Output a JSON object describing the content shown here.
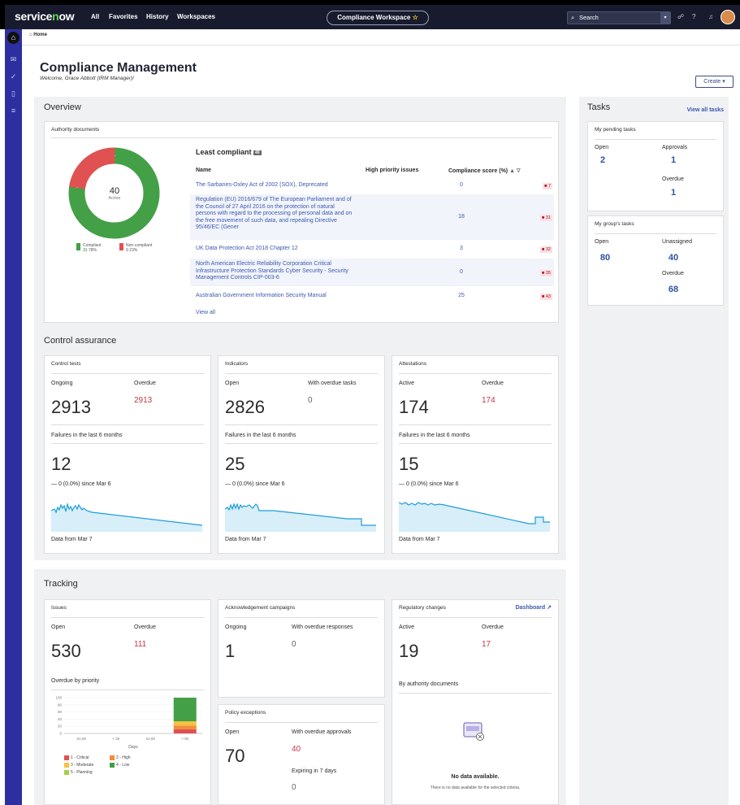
{
  "topbar": {
    "brand": "servicenow",
    "nav": [
      "All",
      "Favorites",
      "History",
      "Workspaces"
    ],
    "workspace": "Compliance Workspace",
    "search_placeholder": "Search"
  },
  "breadcrumb": "Home",
  "page": {
    "title": "Compliance Management",
    "welcome": "Welcome, Grace Abbott (IRM Manager)!",
    "create_label": "Create ▾"
  },
  "overview": {
    "heading": "Overview",
    "authority": {
      "title": "Authority documents",
      "center_value": "40",
      "center_label": "Active",
      "legend": [
        {
          "label": "Compliant",
          "count": "31",
          "pct": "78%",
          "color": "#43a047"
        },
        {
          "label": "Non-compliant",
          "count": "9",
          "pct": "23%",
          "color": "#e05252"
        }
      ],
      "least_title": "Least compliant",
      "least_badge": "40",
      "col_name": "Name",
      "col_high": "High priority issues",
      "col_score": "Compliance score (%)",
      "sort_icon": "▲ ∇",
      "rows": [
        {
          "name": "The Sarbanes-Oxley Act of 2002 (SOX), Deprecated",
          "high": "0",
          "score": "7"
        },
        {
          "name": "Regulation (EU) 2016/679 of The European Parliament and of the Council of 27 April 2016 on the protection of natural persons with regard to the processing of personal data and on the free movement of such data, and repealing Directive 95/46/EC (Gener",
          "high": "18",
          "score": "31"
        },
        {
          "name": "UK Data Protection Act 2018 Chapter 12",
          "high": "3",
          "score": "32"
        },
        {
          "name": "North American Electric Reliability Corporation Critical Infrastructure Protection Standards Cyber Security - Security Management Controls CIP-003-6",
          "high": "0",
          "score": "35"
        },
        {
          "name": "Australian Government Information Security Manual",
          "high": "25",
          "score": "43"
        }
      ],
      "view_all": "View all"
    }
  },
  "control_assurance": {
    "heading": "Control assurance",
    "cards": [
      {
        "title": "Control tests",
        "l1": "Ongoing",
        "v1": "2913",
        "l2": "Overdue",
        "v2": "2913",
        "failures_label": "Failures in the last 6 months",
        "failures": "12",
        "delta": "— 0 (0.0%) since Mar 6",
        "footer": "Data from Mar 7"
      },
      {
        "title": "Indicators",
        "l1": "Open",
        "v1": "2826",
        "l2": "With overdue tasks",
        "v2": "0",
        "failures_label": "Failures in the last 6 months",
        "failures": "25",
        "delta": "— 0 (0.0%) since Mar 6",
        "footer": "Data from Mar 7"
      },
      {
        "title": "Attestations",
        "l1": "Active",
        "v1": "174",
        "l2": "Overdue",
        "v2": "174",
        "failures_label": "Failures in the last 6 months",
        "failures": "15",
        "delta": "— 0 (0.0%) since Mar 6",
        "footer": "Data from Mar 7"
      }
    ]
  },
  "tasks": {
    "heading": "Tasks",
    "view_all": "View all tasks",
    "pending": {
      "title": "My pending tasks",
      "open_label": "Open",
      "open": "2",
      "approvals_label": "Approvals",
      "approvals": "1",
      "overdue_label": "Overdue",
      "overdue": "1"
    },
    "group": {
      "title": "My group's tasks",
      "open_label": "Open",
      "open": "80",
      "unassigned_label": "Unassigned",
      "unassigned": "40",
      "overdue_label": "Overdue",
      "overdue": "68"
    }
  },
  "tracking": {
    "heading": "Tracking",
    "issues": {
      "title": "Issues",
      "l1": "Open",
      "v1": "530",
      "l2": "Overdue",
      "v2": "111",
      "chart_title": "Overdue by priority",
      "y_ticks": [
        "100",
        "80",
        "60",
        "40",
        "20",
        "0"
      ],
      "x_ticks": [
        "61-90",
        "< 30",
        "31-60",
        "> 90"
      ],
      "x_label": "Days",
      "legend": [
        {
          "label": "1 - Critical",
          "color": "#e05252"
        },
        {
          "label": "2 - High",
          "color": "#f28c38"
        },
        {
          "label": "3 - Moderate",
          "color": "#f5c242"
        },
        {
          "label": "4 - Low",
          "color": "#43a047"
        },
        {
          "label": "5 - Planning",
          "color": "#a5cf4a"
        }
      ]
    },
    "ack": {
      "title": "Acknowledgement campaigns",
      "l1": "Ongoing",
      "v1": "1",
      "l2": "With overdue responses",
      "v2": "0"
    },
    "policy": {
      "title": "Policy exceptions",
      "l1": "Open",
      "v1": "70",
      "l2": "With overdue approvals",
      "v2": "40",
      "l3": "Expiring in 7 days",
      "v3": "0"
    },
    "regulatory": {
      "title": "Regulatory changes",
      "dashboard": "Dashboard",
      "l1": "Active",
      "v1": "19",
      "l2": "Overdue",
      "v2": "17",
      "by_authority": "By authority documents",
      "no_data": "No data available.",
      "no_data_sub": "There is no data available for the selected criteria."
    }
  },
  "chart_data": {
    "type": "bar",
    "title": "Overdue by priority",
    "xlabel": "Days",
    "ylabel": "",
    "categories": [
      "61-90",
      "< 30",
      "31-60",
      "> 90"
    ],
    "ylim": [
      0,
      100
    ],
    "series": [
      {
        "name": "1 - Critical",
        "values": [
          0,
          0,
          0,
          12
        ]
      },
      {
        "name": "2 - High",
        "values": [
          0,
          0,
          0,
          10
        ]
      },
      {
        "name": "3 - Moderate",
        "values": [
          0,
          0,
          0,
          12
        ]
      },
      {
        "name": "4 - Low",
        "values": [
          0,
          0,
          0,
          66
        ]
      },
      {
        "name": "5 - Planning",
        "values": [
          0,
          0,
          0,
          0
        ]
      }
    ]
  }
}
